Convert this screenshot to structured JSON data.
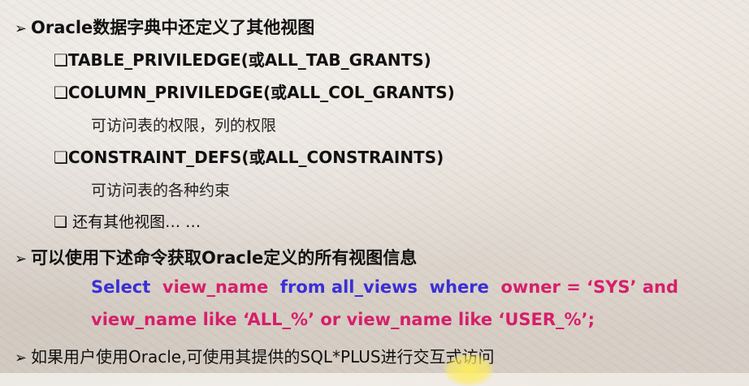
{
  "slide": {
    "heading1": "Oracle数据字典中还定义了其他视图",
    "item_table_priv": "❑TABLE_PRIVILEDGE(或ALL_TAB_GRANTS)",
    "item_column_priv": "❑COLUMN_PRIVILEDGE(或ALL_COL_GRANTS)",
    "desc_priv": "可访问表的权限，列的权限",
    "item_constraint": "❑CONSTRAINT_DEFS(或ALL_CONSTRAINTS)",
    "desc_constraint": "可访问表的各种约束",
    "item_other": "❑ 还有其他视图… …",
    "heading2": "可以使用下述命令获取Oracle定义的所有视图信息",
    "sql_line1": {
      "select": "Select",
      "view_name": "view_name",
      "from": "from all_views",
      "where": "where",
      "rest": "owner = ‘SYS’ and"
    },
    "sql_line2": "view_name like ‘ALL_%’ or view_name like ‘USER_%’;",
    "heading3": "如果用户使用Oracle,可使用其提供的SQL*PLUS进行交互式访问",
    "arrow": "➢",
    "colors": {
      "keyword": "#3b2fd6",
      "identifier": "#d61f6a"
    }
  }
}
